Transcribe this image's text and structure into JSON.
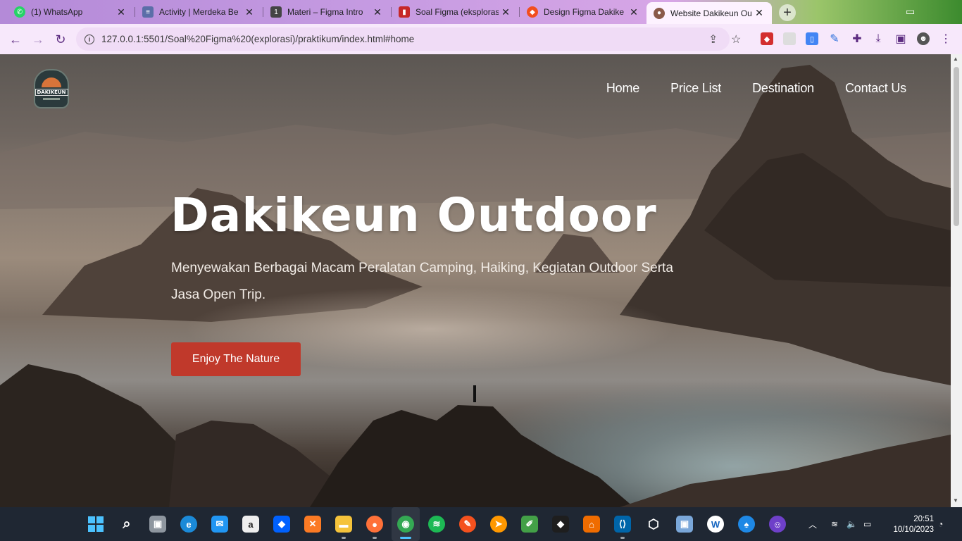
{
  "browser": {
    "tabs": [
      {
        "title": "(1) WhatsApp",
        "icon": "whatsapp-icon",
        "color": "#25d366"
      },
      {
        "title": "Activity | Merdeka Be",
        "icon": "merdeka-icon",
        "color": "#5b6ea8"
      },
      {
        "title": "Materi – Figma Intro",
        "icon": "one-icon",
        "color": "#444444"
      },
      {
        "title": "Soal Figma (eksplorasi",
        "icon": "book-icon",
        "color": "#c62828"
      },
      {
        "title": "Design Figma Dakike",
        "icon": "figma-icon",
        "color": "#f24e1e"
      },
      {
        "title": "Website Dakikeun Ou",
        "icon": "site-icon",
        "color": "#8a5a4a"
      }
    ],
    "url": "127.0.0.1:5501/Soal%20Figma%20(explorasi)/praktikum/index.html#home"
  },
  "site": {
    "logo_text": "DAKIKEUN",
    "nav": [
      "Home",
      "Price List",
      "Destination",
      "Contact Us"
    ],
    "hero_title": "Dakikeun Outdoor",
    "hero_subtitle": "Menyewakan Berbagai Macam Peralatan Camping, Haiking, Kegiatan Outdoor Serta Jasa Open Trip.",
    "cta_label": "Enjoy The Nature",
    "accent": "#c0392b"
  },
  "taskbar": {
    "time": "20:51",
    "date": "10/10/2023"
  }
}
